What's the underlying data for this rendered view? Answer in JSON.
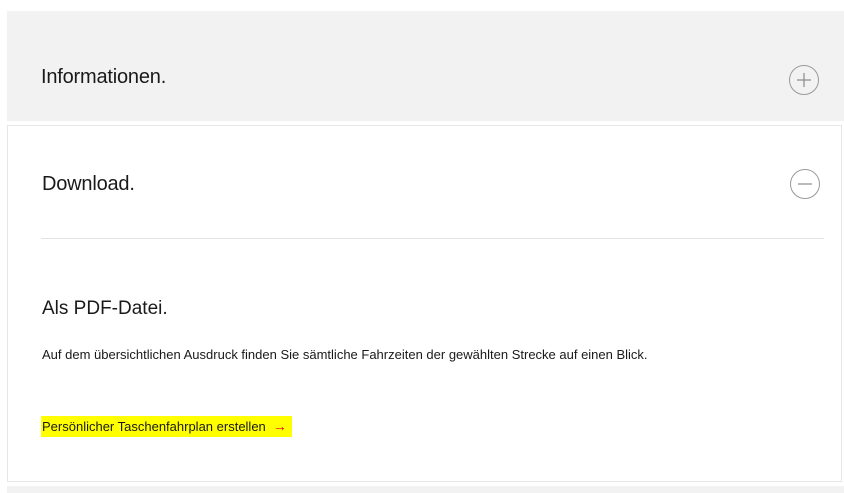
{
  "informationen": {
    "title": "Informationen.",
    "toggle_icon": "plus-icon",
    "expanded": false
  },
  "download": {
    "title": "Download.",
    "toggle_icon": "minus-icon",
    "expanded": true,
    "subtitle": "Als PDF-Datei.",
    "description": "Auf dem übersichtlichen Ausdruck finden Sie sämtliche Fahrzeiten der gewählten Strecke auf einen Blick.",
    "link_label": "Persönlicher Taschenfahrplan erstellen",
    "link_arrow": "→",
    "link_arrow_icon": "arrow-right-icon"
  },
  "colors": {
    "highlight": "#ffff00",
    "accent_red": "#e2001a",
    "panel_grey": "#f2f2f2"
  }
}
